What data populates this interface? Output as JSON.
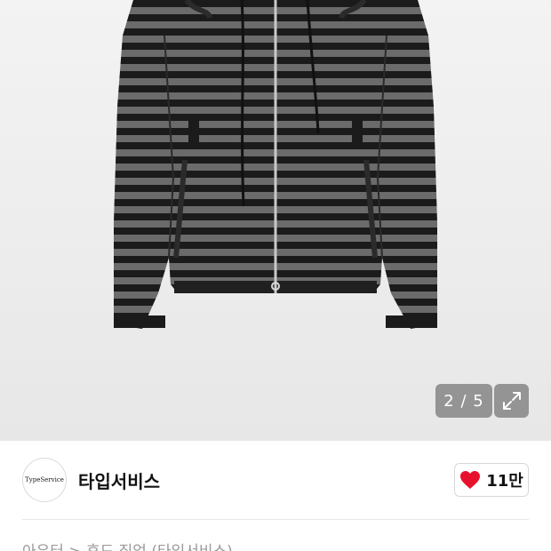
{
  "gallery": {
    "image_alt": "striped zip-up hooded jacket",
    "counter_current": "2",
    "counter_separator": " / ",
    "counter_total": "5",
    "expand_icon": "expand-arrows-icon"
  },
  "store": {
    "logo_text": "TypeService",
    "name": "타입서비스",
    "like_icon": "heart-icon",
    "like_count": "11만",
    "like_color": "#e8112d"
  },
  "breadcrumb": {
    "text": "아우터 > 후드 집업 (타입서비스)"
  }
}
